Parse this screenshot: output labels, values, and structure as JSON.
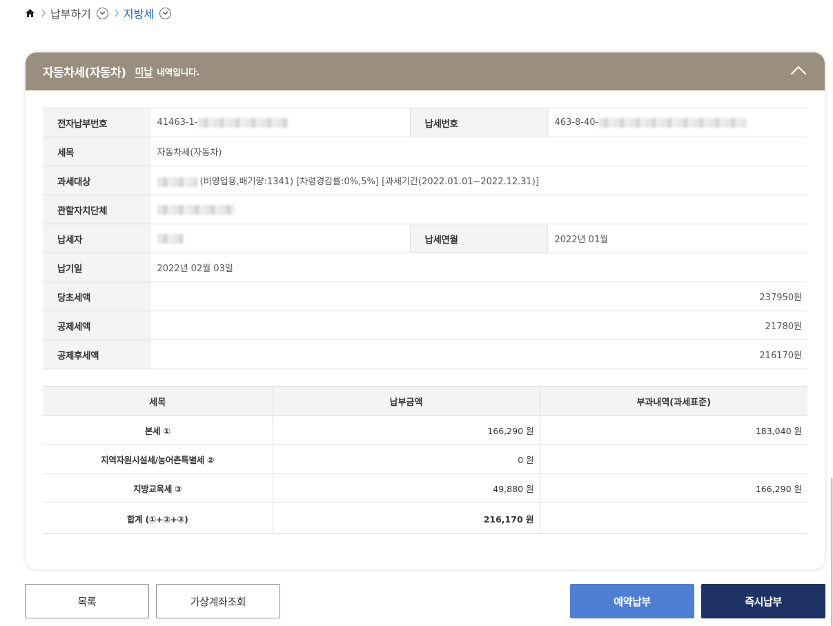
{
  "breadcrumb": {
    "items": [
      "납부하기",
      "지방세"
    ],
    "home_icon": "home-icon",
    "separator_icon": "chevron-right-icon",
    "dropdown_icon": "chevron-down-circle-icon",
    "current_color": "#1f5fbf"
  },
  "card": {
    "title": "자동차세(자동차)",
    "status": "미납",
    "suffix": "내역입니다.",
    "header_color": "#9a8f7e",
    "collapse_icon": "chevron-up-icon"
  },
  "info": {
    "electronic_no_label": "전자납부번호",
    "electronic_no_value": "41463-1-",
    "tax_no_label": "납세번호",
    "tax_no_value": "463-8-40-",
    "item_label": "세목",
    "item_value": "자동차세(자동차)",
    "target_label": "과세대상",
    "target_value": "(비영업용,배기량:1341) [차령경감률:0%,5%] [과세기간(2022.01.01~2022.12.31)]",
    "authority_label": "관할자치단체",
    "payer_label": "납세자",
    "year_month_label": "납세연월",
    "year_month_value": "2022년 01월",
    "due_label": "납기일",
    "due_value": "2022년 02월 03일",
    "initial_tax_label": "당초세액",
    "initial_tax_value": "237950원",
    "deduction_label": "공제세액",
    "deduction_value": "21780원",
    "after_deduction_label": "공제후세액",
    "after_deduction_value": "216170원"
  },
  "detail": {
    "headers": [
      "세목",
      "납부금액",
      "부과내역(과세표준)"
    ],
    "rows": [
      {
        "item": "본세 ①",
        "amount": "166,290 원",
        "base": "183,040 원"
      },
      {
        "item": "지역자원시설세/농어촌특별세 ②",
        "amount": "0 원",
        "base": ""
      },
      {
        "item": "지방교육세 ③",
        "amount": "49,880 원",
        "base": "166,290 원"
      },
      {
        "item": "합계 (①+②+③)",
        "amount": "216,170 원",
        "base": ""
      }
    ]
  },
  "buttons": {
    "list": "목록",
    "virtual_account": "가상계좌조회",
    "reserve": "예약납부",
    "pay_now": "즉시납부",
    "reserve_color": "#4f7fd3",
    "pay_now_color": "#1f3266"
  }
}
